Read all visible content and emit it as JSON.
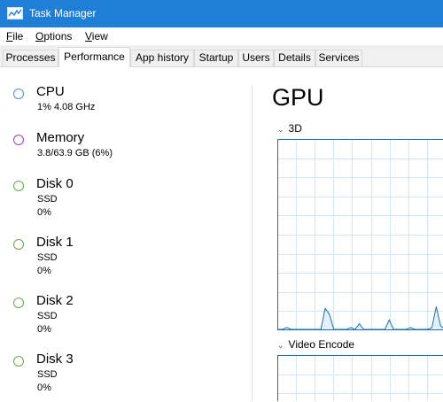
{
  "window": {
    "title": "Task Manager"
  },
  "menu": [
    {
      "label": "File",
      "key": "F",
      "rest": "ile"
    },
    {
      "label": "Options",
      "key": "O",
      "rest": "ptions"
    },
    {
      "label": "View",
      "key": "V",
      "rest": "iew"
    }
  ],
  "tabs": [
    "Processes",
    "Performance",
    "App history",
    "Startup",
    "Users",
    "Details",
    "Services"
  ],
  "active_tab": "Performance",
  "sidebar": [
    {
      "name": "CPU",
      "line1": "1% 4.08 GHz",
      "line2": "",
      "color": "#4a90d9",
      "icon": "cpu-ring-icon"
    },
    {
      "name": "Memory",
      "line1": "3.8/63.9 GB (6%)",
      "line2": "",
      "color": "#a43cb8",
      "icon": "memory-ring-icon"
    },
    {
      "name": "Disk 0",
      "line1": "SSD",
      "line2": "0%",
      "color": "#6aa84f",
      "icon": "disk-ring-icon"
    },
    {
      "name": "Disk 1",
      "line1": "SSD",
      "line2": "0%",
      "color": "#6aa84f",
      "icon": "disk-ring-icon"
    },
    {
      "name": "Disk 2",
      "line1": "SSD",
      "line2": "0%",
      "color": "#6aa84f",
      "icon": "disk-ring-icon"
    },
    {
      "name": "Disk 3",
      "line1": "SSD",
      "line2": "0%",
      "color": "#6aa84f",
      "icon": "disk-ring-icon"
    }
  ],
  "detail": {
    "title": "GPU",
    "graphs": [
      {
        "label": "3D",
        "utilization": [
          0,
          0,
          1,
          0,
          0,
          0,
          0,
          0,
          0,
          0,
          0,
          11,
          8,
          0,
          0,
          0,
          0,
          1,
          0,
          3,
          0,
          0,
          0,
          0,
          0,
          0,
          5,
          0,
          0,
          0,
          0,
          1,
          0,
          0,
          0,
          0,
          1,
          12,
          2,
          0
        ]
      },
      {
        "label": "Video Encode",
        "utilization": []
      }
    ]
  },
  "colors": {
    "titlebar": "#1f7fd6",
    "graph_line": "#1a6fb5",
    "graph_fill": "#e6f0f9",
    "grid": "#d6e6f4"
  }
}
